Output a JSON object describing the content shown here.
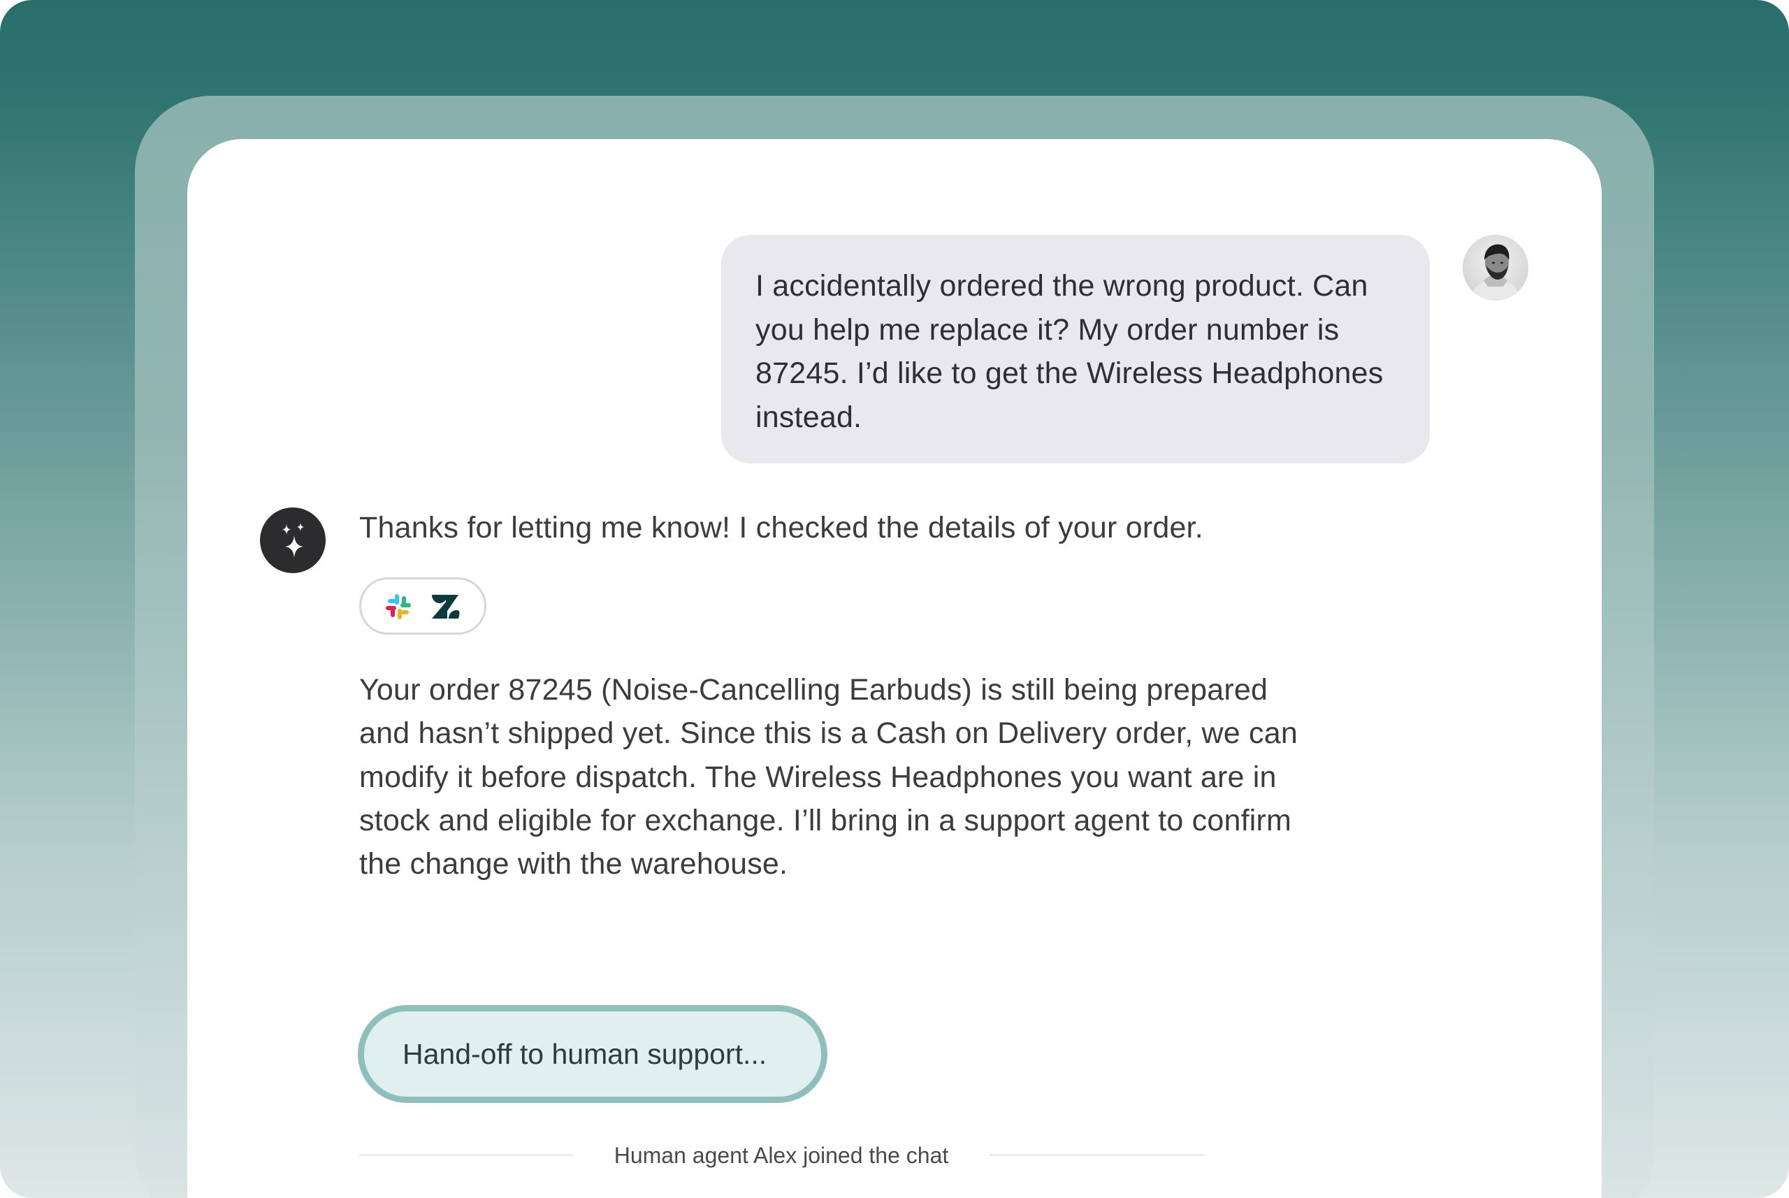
{
  "theme": {
    "background_top": "#296e6a",
    "background_bottom": "#dde7e6",
    "user_bubble": "#e9e8ec",
    "ai_avatar": "#2c2c2e",
    "handoff_border": "#8fbfbd",
    "handoff_fill": "#dff0ef"
  },
  "chat": {
    "user_message": {
      "text": "I accidentally ordered the wrong product. Can you help me replace it? My order number is 87245. I’d like to get the Wireless Headphones instead.",
      "avatar_icon": "user-avatar-photo"
    },
    "assistant": {
      "avatar_icon": "sparkle-icon",
      "intro": "Thanks for letting me know! I checked the details of your order.",
      "sources": [
        {
          "icon": "slack-icon"
        },
        {
          "icon": "zendesk-icon"
        }
      ],
      "body": "Your order 87245 (Noise-Cancelling Earbuds) is still being prepared and hasn’t shipped yet. Since this is a Cash on Delivery order, we can modify it before dispatch. The Wireless Headphones you want are in stock and eligible for exchange. I’ll bring in a support agent to confirm the change with the warehouse."
    },
    "handoff_button": "Hand-off to human support...",
    "system_notice": "Human agent Alex joined the chat"
  }
}
